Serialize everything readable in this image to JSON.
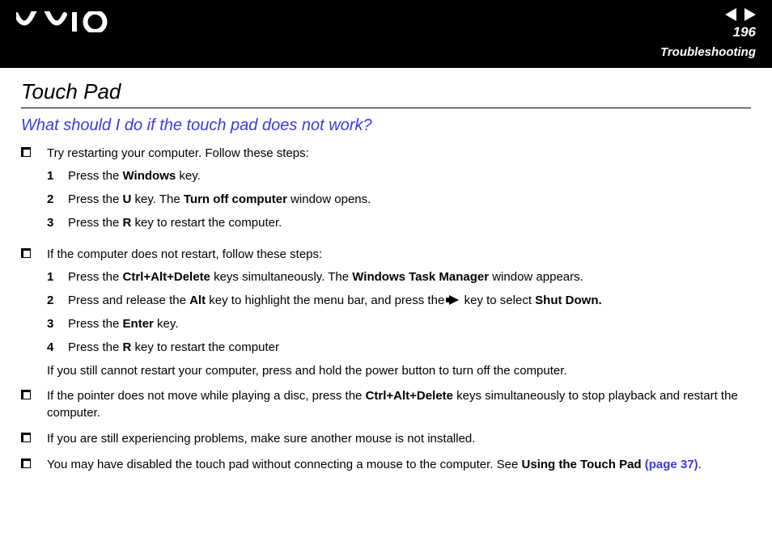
{
  "header": {
    "page_number": "196",
    "section": "Troubleshooting"
  },
  "title": "Touch Pad",
  "subtitle": "What should I do if the touch pad does not work?",
  "bullets": [
    {
      "text": "Try restarting your computer. Follow these steps:",
      "steps": [
        {
          "n": "1",
          "pre": "Press the ",
          "bold1": "Windows",
          "post1": " key."
        },
        {
          "n": "2",
          "pre": "Press the ",
          "bold1": "U",
          "post1": " key. The ",
          "bold2": "Turn off computer",
          "post2": " window opens."
        },
        {
          "n": "3",
          "pre": "Press the ",
          "bold1": "R",
          "post1": " key to restart the computer."
        }
      ]
    },
    {
      "text": "If the computer does not restart, follow these steps:",
      "steps": [
        {
          "n": "1",
          "pre": "Press the ",
          "bold1": "Ctrl+Alt+Delete",
          "post1": " keys simultaneously. The ",
          "bold2": "Windows Task Manager",
          "post2": " window appears."
        },
        {
          "n": "2",
          "pre": "Press and release the ",
          "bold1": "Alt",
          "post1": " key to highlight the menu bar, and press the ",
          "arrow": true,
          "post_arrow": " key to select ",
          "bold2": "Shut Down.",
          "post2": ""
        },
        {
          "n": "3",
          "pre": "Press the ",
          "bold1": "Enter",
          "post1": " key."
        },
        {
          "n": "4",
          "pre": "Press the ",
          "bold1": "R",
          "post1": " key to restart the computer"
        }
      ],
      "after_steps": "If you still cannot restart your computer, press and hold the power button to turn off the computer."
    },
    {
      "text_pre": "If the pointer does not move while playing a disc, press the ",
      "text_bold": "Ctrl+Alt+Delete",
      "text_post": " keys simultaneously to stop playback and restart the computer."
    },
    {
      "text": "If you are still experiencing problems, make sure another mouse is not installed."
    },
    {
      "text_pre": "You may have disabled the touch pad without connecting a mouse to the computer. See ",
      "text_bold": "Using the Touch Pad",
      "text_post": " ",
      "link": "(page 37)",
      "text_end": "."
    }
  ]
}
